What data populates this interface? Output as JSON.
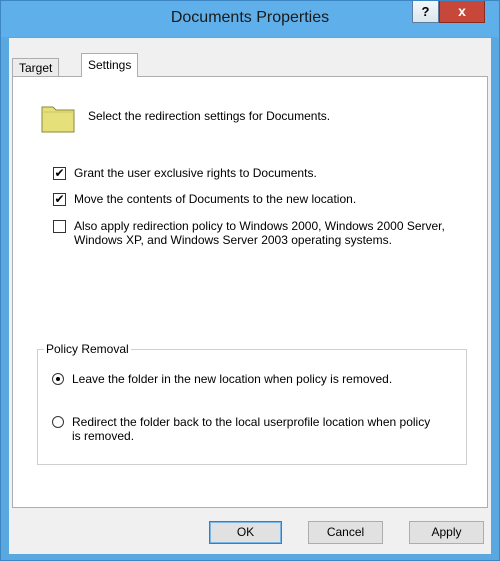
{
  "window": {
    "title": "Documents Properties",
    "help_label": "?",
    "close_label": "x"
  },
  "tabs": [
    {
      "label": "Target",
      "active": false
    },
    {
      "label": "Settings",
      "active": true
    }
  ],
  "intro_text": "Select the redirection settings for Documents.",
  "checkboxes": [
    {
      "label": "Grant the user exclusive rights to Documents.",
      "checked": true
    },
    {
      "label": "Move the contents of Documents to the new location.",
      "checked": true
    },
    {
      "label": "Also apply redirection policy to Windows 2000, Windows 2000 Server, Windows XP, and Windows Server 2003 operating systems.",
      "checked": false
    }
  ],
  "policy_removal": {
    "title": "Policy Removal",
    "options": [
      {
        "label": "Leave the folder in the new location when policy is removed.",
        "selected": true
      },
      {
        "label": "Redirect the folder back to the local userprofile location when policy is removed.",
        "selected": false
      }
    ]
  },
  "buttons": {
    "ok": "OK",
    "cancel": "Cancel",
    "apply": "Apply"
  },
  "check_glyph": "✔",
  "colors": {
    "titlebar": "#5fb0ea",
    "close": "#c7473a",
    "folder": "#e6e07a"
  }
}
